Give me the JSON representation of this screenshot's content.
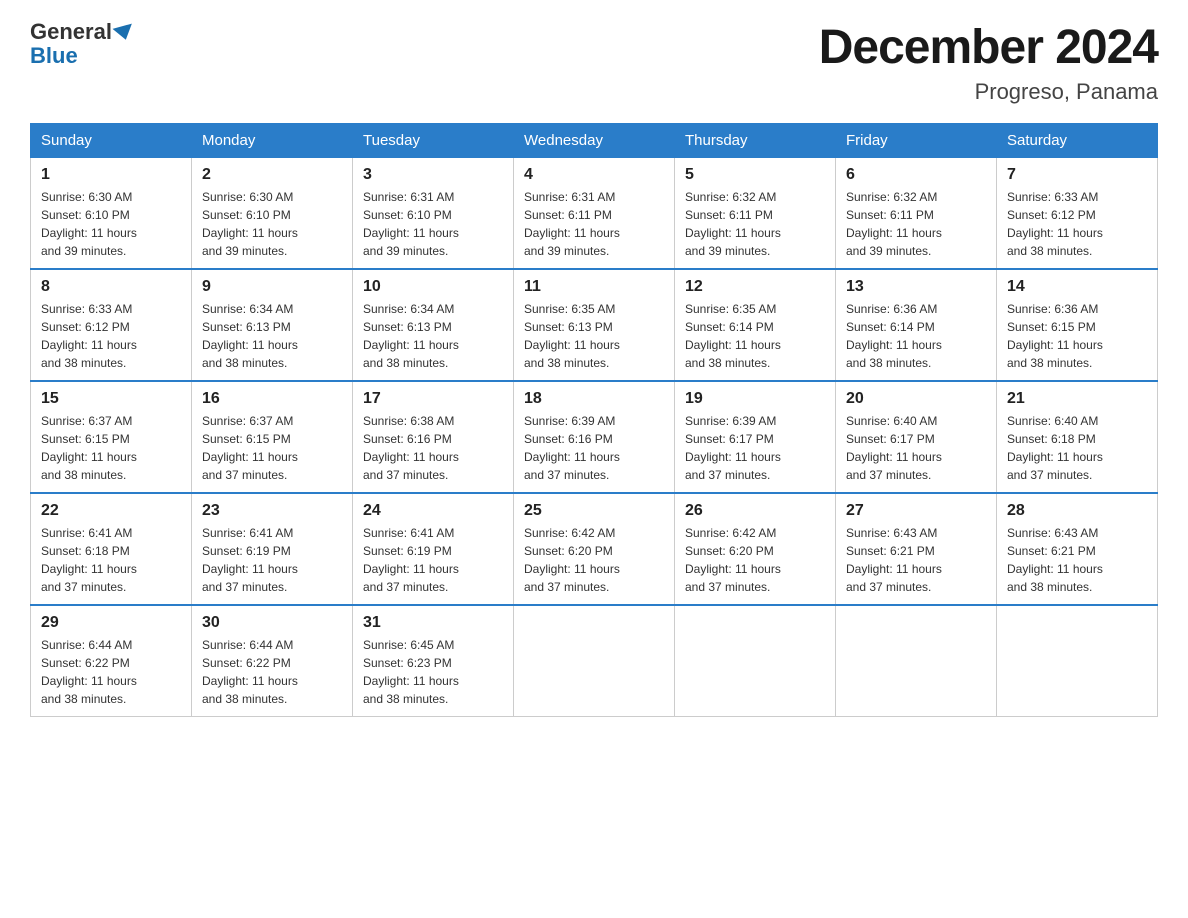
{
  "header": {
    "logo_line1": "General",
    "logo_line2": "Blue",
    "month_year": "December 2024",
    "location": "Progreso, Panama"
  },
  "days_of_week": [
    "Sunday",
    "Monday",
    "Tuesday",
    "Wednesday",
    "Thursday",
    "Friday",
    "Saturday"
  ],
  "weeks": [
    [
      {
        "day": "1",
        "sunrise": "6:30 AM",
        "sunset": "6:10 PM",
        "daylight": "11 hours and 39 minutes."
      },
      {
        "day": "2",
        "sunrise": "6:30 AM",
        "sunset": "6:10 PM",
        "daylight": "11 hours and 39 minutes."
      },
      {
        "day": "3",
        "sunrise": "6:31 AM",
        "sunset": "6:10 PM",
        "daylight": "11 hours and 39 minutes."
      },
      {
        "day": "4",
        "sunrise": "6:31 AM",
        "sunset": "6:11 PM",
        "daylight": "11 hours and 39 minutes."
      },
      {
        "day": "5",
        "sunrise": "6:32 AM",
        "sunset": "6:11 PM",
        "daylight": "11 hours and 39 minutes."
      },
      {
        "day": "6",
        "sunrise": "6:32 AM",
        "sunset": "6:11 PM",
        "daylight": "11 hours and 39 minutes."
      },
      {
        "day": "7",
        "sunrise": "6:33 AM",
        "sunset": "6:12 PM",
        "daylight": "11 hours and 38 minutes."
      }
    ],
    [
      {
        "day": "8",
        "sunrise": "6:33 AM",
        "sunset": "6:12 PM",
        "daylight": "11 hours and 38 minutes."
      },
      {
        "day": "9",
        "sunrise": "6:34 AM",
        "sunset": "6:13 PM",
        "daylight": "11 hours and 38 minutes."
      },
      {
        "day": "10",
        "sunrise": "6:34 AM",
        "sunset": "6:13 PM",
        "daylight": "11 hours and 38 minutes."
      },
      {
        "day": "11",
        "sunrise": "6:35 AM",
        "sunset": "6:13 PM",
        "daylight": "11 hours and 38 minutes."
      },
      {
        "day": "12",
        "sunrise": "6:35 AM",
        "sunset": "6:14 PM",
        "daylight": "11 hours and 38 minutes."
      },
      {
        "day": "13",
        "sunrise": "6:36 AM",
        "sunset": "6:14 PM",
        "daylight": "11 hours and 38 minutes."
      },
      {
        "day": "14",
        "sunrise": "6:36 AM",
        "sunset": "6:15 PM",
        "daylight": "11 hours and 38 minutes."
      }
    ],
    [
      {
        "day": "15",
        "sunrise": "6:37 AM",
        "sunset": "6:15 PM",
        "daylight": "11 hours and 38 minutes."
      },
      {
        "day": "16",
        "sunrise": "6:37 AM",
        "sunset": "6:15 PM",
        "daylight": "11 hours and 37 minutes."
      },
      {
        "day": "17",
        "sunrise": "6:38 AM",
        "sunset": "6:16 PM",
        "daylight": "11 hours and 37 minutes."
      },
      {
        "day": "18",
        "sunrise": "6:39 AM",
        "sunset": "6:16 PM",
        "daylight": "11 hours and 37 minutes."
      },
      {
        "day": "19",
        "sunrise": "6:39 AM",
        "sunset": "6:17 PM",
        "daylight": "11 hours and 37 minutes."
      },
      {
        "day": "20",
        "sunrise": "6:40 AM",
        "sunset": "6:17 PM",
        "daylight": "11 hours and 37 minutes."
      },
      {
        "day": "21",
        "sunrise": "6:40 AM",
        "sunset": "6:18 PM",
        "daylight": "11 hours and 37 minutes."
      }
    ],
    [
      {
        "day": "22",
        "sunrise": "6:41 AM",
        "sunset": "6:18 PM",
        "daylight": "11 hours and 37 minutes."
      },
      {
        "day": "23",
        "sunrise": "6:41 AM",
        "sunset": "6:19 PM",
        "daylight": "11 hours and 37 minutes."
      },
      {
        "day": "24",
        "sunrise": "6:41 AM",
        "sunset": "6:19 PM",
        "daylight": "11 hours and 37 minutes."
      },
      {
        "day": "25",
        "sunrise": "6:42 AM",
        "sunset": "6:20 PM",
        "daylight": "11 hours and 37 minutes."
      },
      {
        "day": "26",
        "sunrise": "6:42 AM",
        "sunset": "6:20 PM",
        "daylight": "11 hours and 37 minutes."
      },
      {
        "day": "27",
        "sunrise": "6:43 AM",
        "sunset": "6:21 PM",
        "daylight": "11 hours and 37 minutes."
      },
      {
        "day": "28",
        "sunrise": "6:43 AM",
        "sunset": "6:21 PM",
        "daylight": "11 hours and 38 minutes."
      }
    ],
    [
      {
        "day": "29",
        "sunrise": "6:44 AM",
        "sunset": "6:22 PM",
        "daylight": "11 hours and 38 minutes."
      },
      {
        "day": "30",
        "sunrise": "6:44 AM",
        "sunset": "6:22 PM",
        "daylight": "11 hours and 38 minutes."
      },
      {
        "day": "31",
        "sunrise": "6:45 AM",
        "sunset": "6:23 PM",
        "daylight": "11 hours and 38 minutes."
      },
      null,
      null,
      null,
      null
    ]
  ],
  "labels": {
    "sunrise_prefix": "Sunrise: ",
    "sunset_prefix": "Sunset: ",
    "daylight_prefix": "Daylight: "
  }
}
